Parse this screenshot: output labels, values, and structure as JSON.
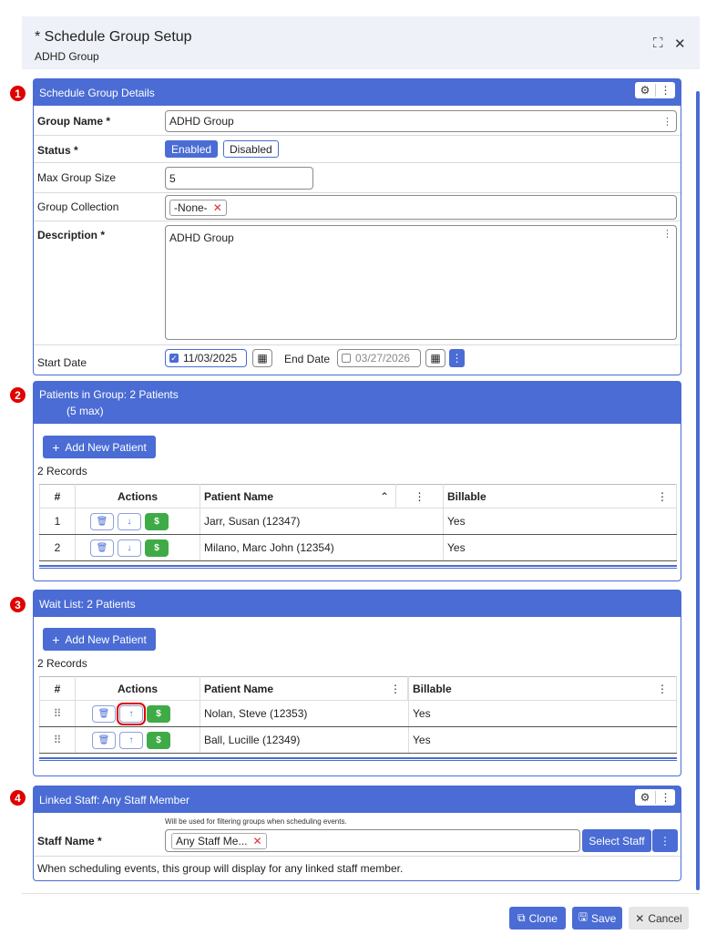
{
  "dialog": {
    "title": "* Schedule Group Setup",
    "subtitle": "ADHD Group",
    "expand_icon": "expand-icon",
    "close_icon": "close-icon"
  },
  "section1": {
    "badge": "1",
    "title": "Schedule Group Details",
    "group_name_label": "Group Name *",
    "group_name_value": "ADHD Group",
    "status_label": "Status *",
    "status_enabled": "Enabled",
    "status_disabled": "Disabled",
    "status_selected": "Enabled",
    "max_size_label": "Max Group Size",
    "max_size_value": "5",
    "collection_label": "Group Collection",
    "collection_value": "-None-",
    "description_label": "Description *",
    "description_value": "ADHD Group",
    "start_label": "Start Date",
    "start_value": "11/03/2025",
    "start_checked": true,
    "end_label": "End Date",
    "end_value": "03/27/2026",
    "end_checked": false
  },
  "section2": {
    "badge": "2",
    "title": "Patients in Group: 2 Patients",
    "subtitle": "(5 max)",
    "add_button": "Add New Patient",
    "records": "2 Records",
    "columns": [
      "#",
      "Actions",
      "Patient Name",
      "Billable"
    ],
    "rows": [
      {
        "num": "1",
        "name": "Jarr, Susan (12347)",
        "billable": "Yes"
      },
      {
        "num": "2",
        "name": "Milano, Marc John (12354)",
        "billable": "Yes"
      }
    ]
  },
  "section3": {
    "badge": "3",
    "title": "Wait List: 2 Patients",
    "add_button": "Add New Patient",
    "records": "2 Records",
    "columns": [
      "#",
      "Actions",
      "Patient Name",
      "Billable"
    ],
    "rows": [
      {
        "name": "Nolan, Steve (12353)",
        "billable": "Yes"
      },
      {
        "name": "Ball, Lucille (12349)",
        "billable": "Yes"
      }
    ]
  },
  "section4": {
    "badge": "4",
    "title": "Linked Staff: Any Staff Member",
    "hint": "Will be used for filtering groups when scheduling events.",
    "staff_label": "Staff Name *",
    "staff_value": "Any Staff Me...",
    "select_button": "Select Staff",
    "note": "When scheduling events, this group will display for any linked staff member."
  },
  "footer": {
    "clone": "Clone",
    "save": "Save",
    "cancel": "Cancel"
  },
  "colors": {
    "accent": "#4a6cd4",
    "badge": "#e00000",
    "green": "#3fab47"
  }
}
